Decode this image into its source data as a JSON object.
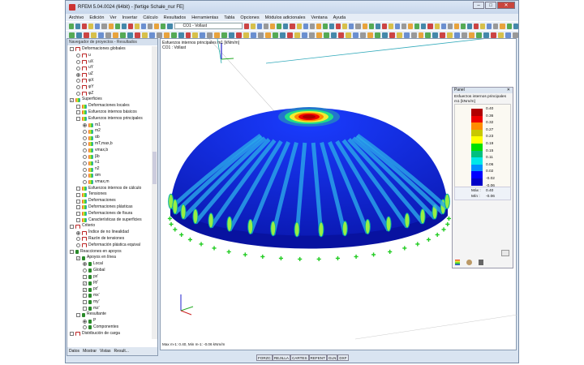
{
  "window": {
    "title": "RFEM 5.04.0024 (64bit) - [fertige Schale_nur FE]"
  },
  "menu": [
    "Archivo",
    "Edición",
    "Ver",
    "Insertar",
    "Cálculo",
    "Resultados",
    "Herramientas",
    "Tabla",
    "Opciones",
    "Módulos adicionales",
    "Ventana",
    "Ayuda"
  ],
  "toolbar": {
    "load_case": "CO1 - Vollast"
  },
  "navigator": {
    "title": "Navegador de proyectos - Resultados",
    "items": [
      {
        "label": "Deformaciones globales",
        "lvl": 0,
        "type": "ck",
        "ic": "def"
      },
      {
        "label": "u",
        "lvl": 1,
        "type": "rd",
        "ic": "def"
      },
      {
        "label": "uX",
        "lvl": 1,
        "type": "rd",
        "ic": "def"
      },
      {
        "label": "uY",
        "lvl": 1,
        "type": "rd",
        "ic": "def"
      },
      {
        "label": "uZ",
        "lvl": 1,
        "type": "rd",
        "on": true,
        "ic": "def"
      },
      {
        "label": "φX",
        "lvl": 1,
        "type": "rd",
        "ic": "def"
      },
      {
        "label": "φY",
        "lvl": 1,
        "type": "rd",
        "ic": "def"
      },
      {
        "label": "φZ",
        "lvl": 1,
        "type": "rd",
        "ic": "def"
      },
      {
        "label": "Superficies",
        "lvl": 0,
        "type": "ck",
        "on": true,
        "ic": "surf"
      },
      {
        "label": "Deformaciones locales",
        "lvl": 1,
        "type": "ck",
        "ic": "surf"
      },
      {
        "label": "Esfuerzos internos básicos",
        "lvl": 1,
        "type": "ck",
        "ic": "surf"
      },
      {
        "label": "Esfuerzos internos principales",
        "lvl": 1,
        "type": "ck",
        "ic": "surf"
      },
      {
        "label": "m1",
        "lvl": 2,
        "type": "rd",
        "on": true,
        "ic": "surf"
      },
      {
        "label": "m2",
        "lvl": 2,
        "type": "rd",
        "ic": "surf"
      },
      {
        "label": "αb",
        "lvl": 2,
        "type": "rd",
        "ic": "surf"
      },
      {
        "label": "mT,max,b",
        "lvl": 2,
        "type": "rd",
        "ic": "surf"
      },
      {
        "label": "vmax,b",
        "lvl": 2,
        "type": "rd",
        "ic": "surf"
      },
      {
        "label": "βb",
        "lvl": 2,
        "type": "rd",
        "ic": "surf"
      },
      {
        "label": "n1",
        "lvl": 2,
        "type": "rd",
        "ic": "surf"
      },
      {
        "label": "n2",
        "lvl": 2,
        "type": "rd",
        "ic": "surf"
      },
      {
        "label": "αm",
        "lvl": 2,
        "type": "rd",
        "ic": "surf"
      },
      {
        "label": "vmax,m",
        "lvl": 2,
        "type": "rd",
        "ic": "surf"
      },
      {
        "label": "Esfuerzos internos de cálculo",
        "lvl": 1,
        "type": "ck",
        "ic": "surf"
      },
      {
        "label": "Tensiones",
        "lvl": 1,
        "type": "ck",
        "ic": "surf"
      },
      {
        "label": "Deformaciones",
        "lvl": 1,
        "type": "ck",
        "ic": "surf"
      },
      {
        "label": "Deformaciones plásticas",
        "lvl": 1,
        "type": "ck",
        "ic": "surf"
      },
      {
        "label": "Deformaciones de fisura",
        "lvl": 1,
        "type": "ck",
        "ic": "surf"
      },
      {
        "label": "Características de superficies",
        "lvl": 1,
        "type": "ck",
        "ic": "surf"
      },
      {
        "label": "Criterio",
        "lvl": 0,
        "type": "ck",
        "ic": "def"
      },
      {
        "label": "Índice de no linealidad",
        "lvl": 1,
        "type": "rd",
        "on": true,
        "ic": "def"
      },
      {
        "label": "Razón de tensiones",
        "lvl": 1,
        "type": "rd",
        "ic": "def"
      },
      {
        "label": "Deformación plástica equival",
        "lvl": 1,
        "type": "rd",
        "ic": "def"
      },
      {
        "label": "Reacciones en apoyos",
        "lvl": 0,
        "type": "ck",
        "ic": "sup"
      },
      {
        "label": "Apoyos en línea",
        "lvl": 1,
        "type": "ck",
        "on": true,
        "ic": "sup"
      },
      {
        "label": "Local",
        "lvl": 2,
        "type": "rd",
        "on": true,
        "ic": "sup"
      },
      {
        "label": "Global",
        "lvl": 2,
        "type": "rd",
        "ic": "sup"
      },
      {
        "label": "px'",
        "lvl": 2,
        "type": "ck",
        "ic": "sup"
      },
      {
        "label": "py'",
        "lvl": 2,
        "type": "ck",
        "on": true,
        "ic": "sup"
      },
      {
        "label": "pz'",
        "lvl": 2,
        "type": "ck",
        "on": true,
        "ic": "sup"
      },
      {
        "label": "mx'",
        "lvl": 2,
        "type": "ck",
        "ic": "sup"
      },
      {
        "label": "my'",
        "lvl": 2,
        "type": "ck",
        "ic": "sup"
      },
      {
        "label": "mz'",
        "lvl": 2,
        "type": "ck",
        "ic": "sup"
      },
      {
        "label": "Resultante",
        "lvl": 1,
        "type": "ck",
        "ic": "sup"
      },
      {
        "label": "P",
        "lvl": 2,
        "type": "rd",
        "on": true,
        "ic": "sup"
      },
      {
        "label": "Componentes",
        "lvl": 2,
        "type": "rd",
        "ic": "sup"
      },
      {
        "label": "Distribución de carga",
        "lvl": 0,
        "type": "ck",
        "ic": "def"
      }
    ],
    "tabs": [
      "Datos",
      "Mostrar",
      "Vistas",
      "Result..."
    ]
  },
  "view": {
    "heading": "Esfuerzos internos principales m1 [kNm/m]",
    "load_case": "CO1 : Vollast",
    "maxmin": "Max m-1: 0.40, Min m-1: -0.06 kNm/m"
  },
  "panel": {
    "title": "Panel",
    "subtitle1": "Esfuerzos internos principales",
    "subtitle2": "m1 [kNm/m]",
    "values": [
      "0.40",
      "0.36",
      "0.32",
      "0.27",
      "0.23",
      "0.19",
      "0.15",
      "0.11",
      "0.06",
      "0.02",
      "-0.02",
      "-0.06"
    ],
    "colors": [
      "#b00000",
      "#ee0000",
      "#ff8c00",
      "#c8c800",
      "#ffff00",
      "#00e000",
      "#00c080",
      "#00e8e8",
      "#0090ff",
      "#0000ff",
      "#0000c8",
      "#000090"
    ],
    "max_label": "Máx :",
    "max": "0.40",
    "min_label": "Mín :",
    "min": "-0.06"
  },
  "statusbar": [
    "FORZC",
    "REJILLA",
    "CARTES",
    "REFENT",
    "GLN",
    "DXF"
  ]
}
